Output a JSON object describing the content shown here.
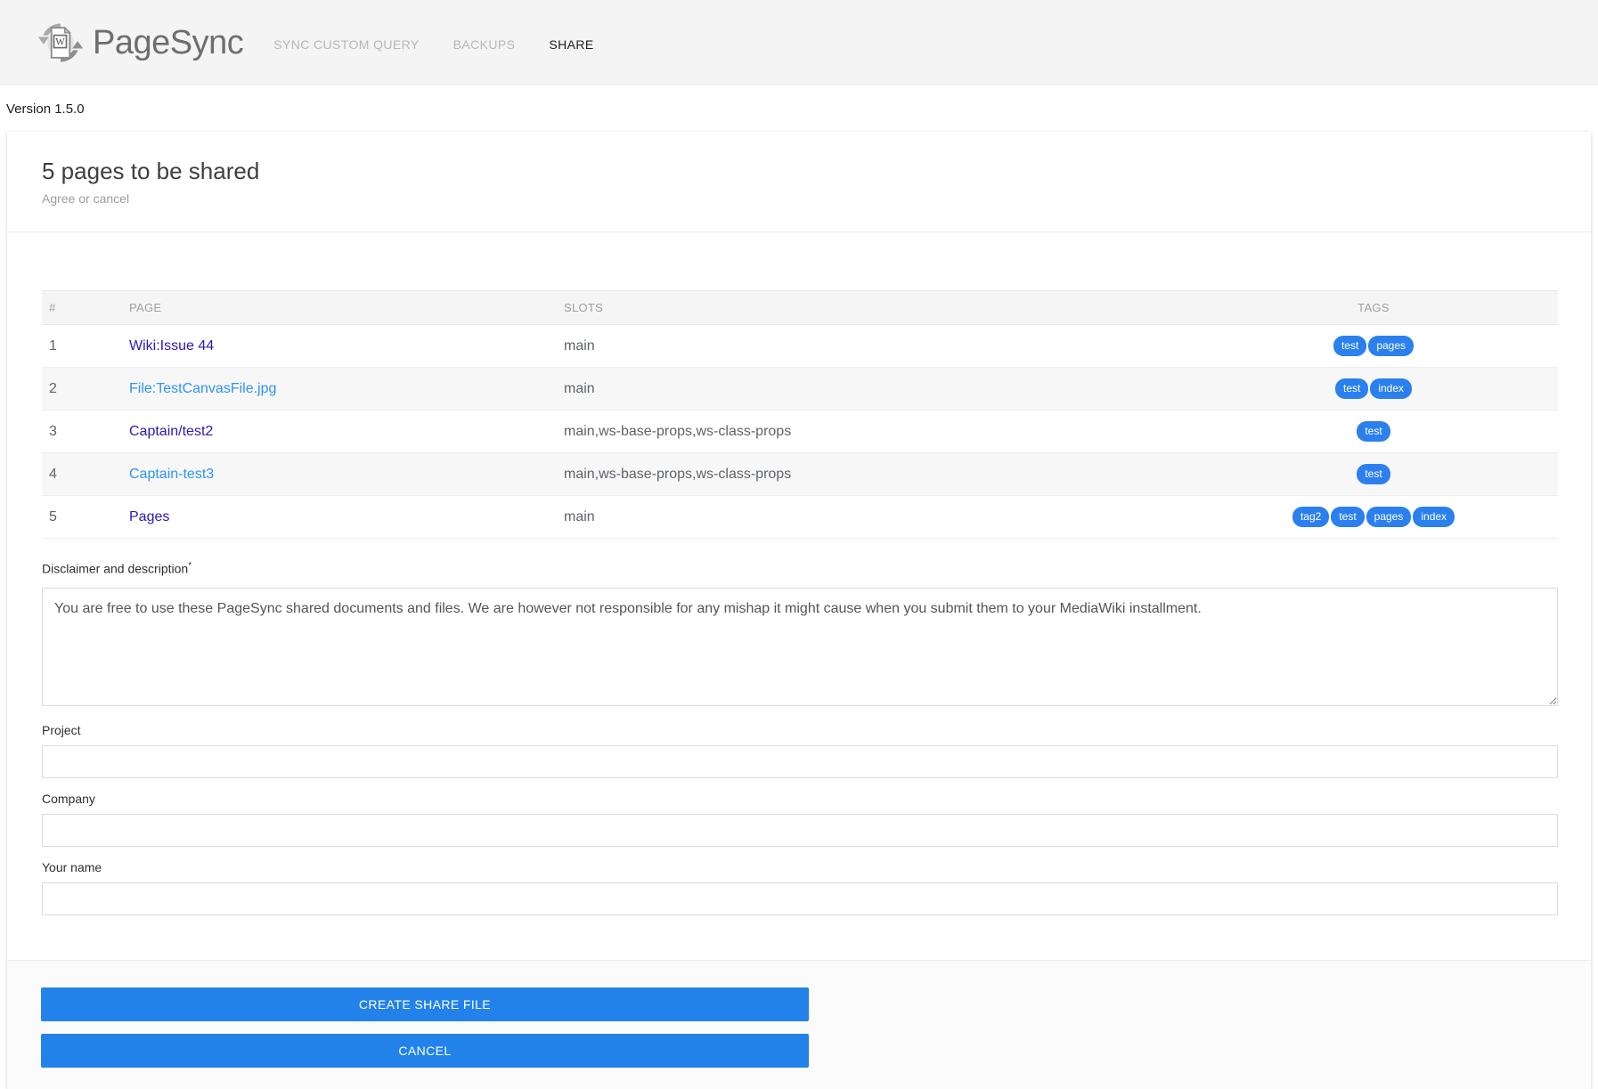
{
  "header": {
    "logo_text": "PageSync",
    "logo_icon": "sync-arrows-document-w-icon",
    "nav": [
      {
        "label": "SYNC CUSTOM QUERY",
        "active": false
      },
      {
        "label": "BACKUPS",
        "active": false
      },
      {
        "label": "SHARE",
        "active": true
      }
    ]
  },
  "version_text": "Version 1.5.0",
  "card": {
    "title": "5 pages to be shared",
    "subtitle": "Agree or cancel",
    "table": {
      "columns": [
        "#",
        "PAGE",
        "SLOTS",
        "TAGS"
      ],
      "rows": [
        {
          "num": "1",
          "page": "Wiki:Issue 44",
          "link_color": "#2a1ab2",
          "slots": "main",
          "tags": [
            "test",
            "pages"
          ]
        },
        {
          "num": "2",
          "page": "File:TestCanvasFile.jpg",
          "link_color": "#2e93f5",
          "slots": "main",
          "tags": [
            "test",
            "index"
          ]
        },
        {
          "num": "3",
          "page": "Captain/test2",
          "link_color": "#2a1ab2",
          "slots": "main,ws-base-props,ws-class-props",
          "tags": [
            "test"
          ]
        },
        {
          "num": "4",
          "page": "Captain-test3",
          "link_color": "#2e93f5",
          "slots": "main,ws-base-props,ws-class-props",
          "tags": [
            "test"
          ]
        },
        {
          "num": "5",
          "page": "Pages",
          "link_color": "#2a1ab2",
          "slots": "main",
          "tags": [
            "tag2",
            "test",
            "pages",
            "index"
          ]
        }
      ]
    },
    "form": {
      "disclaimer_label": "Disclaimer and description",
      "disclaimer_required_mark": "*",
      "disclaimer_value": "You are free to use these PageSync shared documents and files. We are however not responsible for any mishap it might cause when you submit them to your MediaWiki installment.",
      "fields": [
        {
          "label": "Project",
          "value": ""
        },
        {
          "label": "Company",
          "value": ""
        },
        {
          "label": "Your name",
          "value": ""
        }
      ]
    },
    "buttons": [
      {
        "label": "CREATE SHARE FILE"
      },
      {
        "label": "CANCEL"
      }
    ]
  },
  "colors": {
    "header_bg": "#f4f4f4",
    "tag_blue": "#2b80ee",
    "button_blue": "#2282ea",
    "visited_link": "#2a1ab2",
    "link_blue": "#2e93f5"
  }
}
